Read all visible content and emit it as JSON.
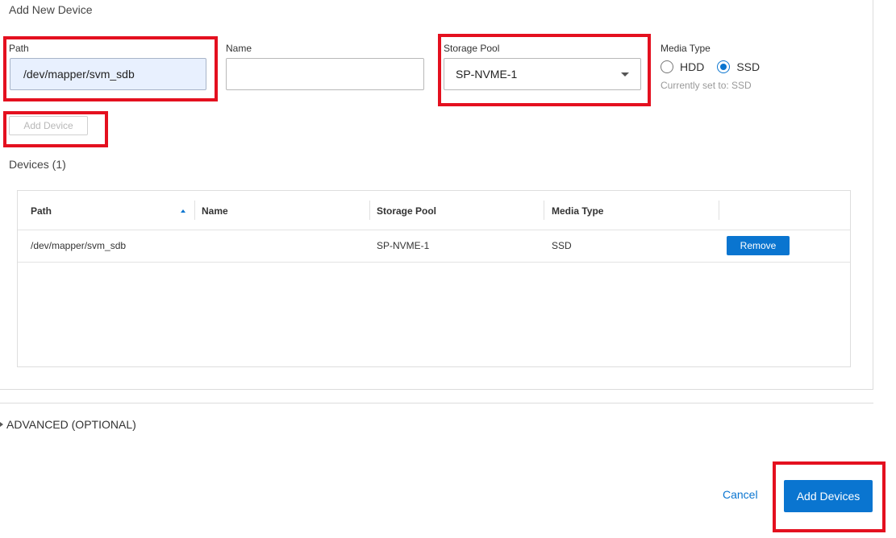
{
  "form": {
    "section_title": "Add New Device",
    "path": {
      "label": "Path",
      "value": "/dev/mapper/svm_sdb"
    },
    "name": {
      "label": "Name",
      "value": ""
    },
    "storage_pool": {
      "label": "Storage Pool",
      "selected": "SP-NVME-1"
    },
    "media_type": {
      "label": "Media Type",
      "options": [
        {
          "label": "HDD",
          "checked": false
        },
        {
          "label": "SSD",
          "checked": true
        }
      ],
      "hint": "Currently set to: SSD"
    },
    "add_device_label": "Add Device"
  },
  "devices": {
    "title": "Devices (1)",
    "columns": [
      "Path",
      "Name",
      "Storage Pool",
      "Media Type"
    ],
    "rows": [
      {
        "path": "/dev/mapper/svm_sdb",
        "name": "",
        "storage_pool": "SP-NVME-1",
        "media_type": "SSD",
        "action": "Remove"
      }
    ]
  },
  "advanced_label": "ADVANCED (OPTIONAL)",
  "footer": {
    "cancel_label": "Cancel",
    "submit_label": "Add Devices"
  },
  "colors": {
    "accent": "#0a75d0",
    "highlight": "#e4101f"
  }
}
